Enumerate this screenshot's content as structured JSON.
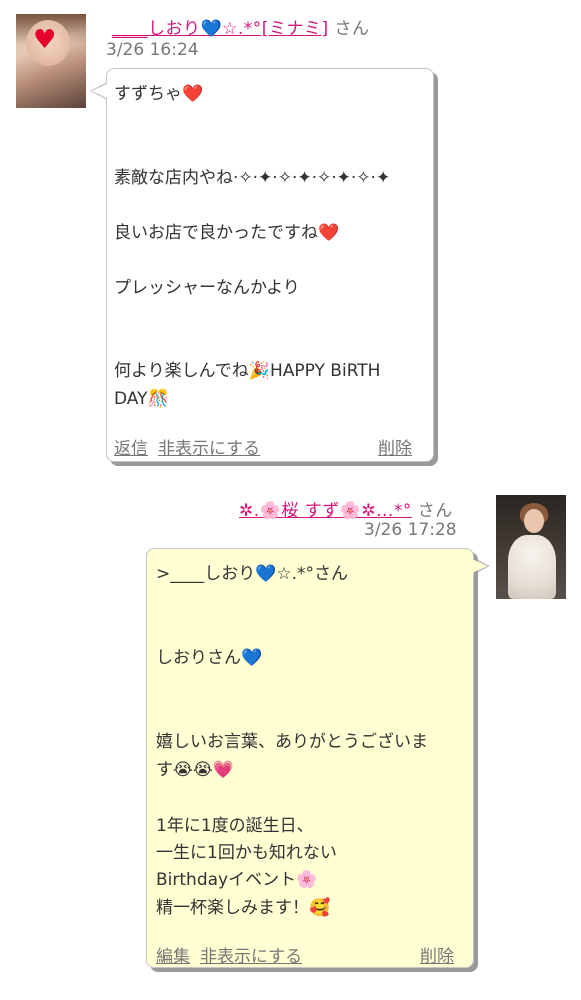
{
  "messages": [
    {
      "sender": {
        "name": "____しおり💙☆.*°[ミナミ]",
        "suffix": "さん"
      },
      "timestamp": "3/26 16:24",
      "lines": [
        "すずちゃ❤️",
        "素敵な店内やね·✧·✦·✧·✦·✧·✦·✧·✦",
        "良いお店で良かったですね❤️",
        "プレッシャーなんかより",
        "何より楽しんでね🎉HAPPY BiRTH",
        "DAY🎊"
      ],
      "actions": {
        "reply": "返信",
        "hide": "非表示にする",
        "delete": "削除"
      },
      "bubble_color": "#ffffff"
    },
    {
      "sender": {
        "name": "✲.🌸桜 すず🌸✲...*°",
        "suffix": "さん"
      },
      "timestamp": "3/26 17:28",
      "lines": [
        ">____しおり💙☆.*°さん",
        "しおりさん💙",
        "嬉しいお言葉、ありがとうございま",
        "す😭😭💗",
        "1年に1度の誕生日、",
        "一生に1回かも知れない",
        "Birthdayイベント🌸",
        "精一杯楽しみます！🥰"
      ],
      "actions": {
        "edit": "編集",
        "hide": "非表示にする",
        "delete": "削除"
      },
      "bubble_color": "#ffffd3"
    }
  ],
  "colors": {
    "name_link": "#d4147a",
    "meta_text": "#777777",
    "body_text": "#333333",
    "bubble_border": "#c6c6c6",
    "bubble_shadow": "#9a9a9a"
  }
}
